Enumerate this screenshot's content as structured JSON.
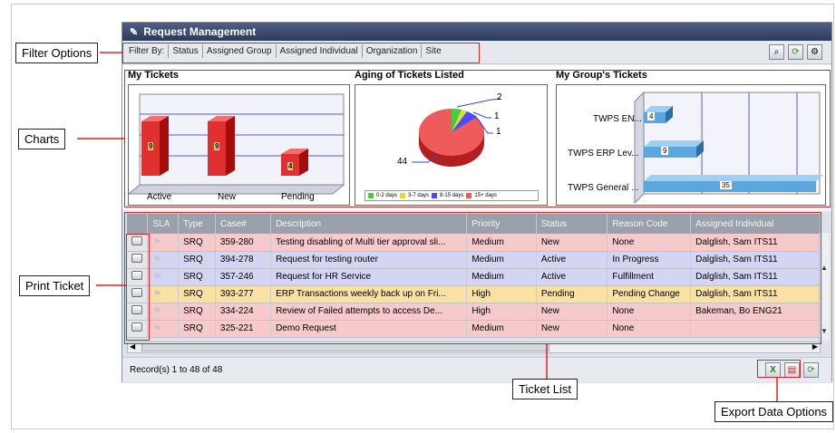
{
  "title": "Request Management",
  "filters": [
    "Filter By:",
    "Status",
    "Assigned Group",
    "Assigned Individual",
    "Organization",
    "Site"
  ],
  "charts": {
    "my_tickets": {
      "title": "My Tickets",
      "categories": [
        "Active",
        "New",
        "Pending"
      ],
      "values": [
        "9",
        "9",
        "4"
      ]
    },
    "aging": {
      "title": "Aging of Tickets Listed",
      "labels": [
        "2",
        "1",
        "1",
        "44"
      ],
      "legend": [
        "0-2 days",
        "3-7 days",
        "8-15 days",
        "15+ days"
      ]
    },
    "group": {
      "title": "My Group's Tickets",
      "categories": [
        "TWPS EN...",
        "TWPS ERP Lev...",
        "TWPS General ..."
      ],
      "values": [
        "4",
        "9",
        "35"
      ]
    }
  },
  "chart_data": [
    {
      "type": "bar",
      "title": "My Tickets",
      "categories": [
        "Active",
        "New",
        "Pending"
      ],
      "values": [
        9,
        9,
        4
      ]
    },
    {
      "type": "pie",
      "title": "Aging of Tickets Listed",
      "categories": [
        "0-2 days",
        "3-7 days",
        "8-15 days",
        "15+ days"
      ],
      "values": [
        1,
        1,
        2,
        44
      ]
    },
    {
      "type": "bar",
      "title": "My Group's Tickets",
      "categories": [
        "TWPS EN...",
        "TWPS ERP Lev...",
        "TWPS General ..."
      ],
      "values": [
        4,
        9,
        35
      ]
    }
  ],
  "table": {
    "columns": [
      "SLA",
      "Type",
      "Case#",
      "Description",
      "Priority",
      "Status",
      "Reason Code",
      "Assigned Individual"
    ],
    "rows": [
      [
        "SRQ",
        "359-280",
        "Testing disabling of Multi tier approval sli...",
        "Medium",
        "New",
        "None",
        "Dalglish, Sam ITS11"
      ],
      [
        "SRQ",
        "394-278",
        "Request for testing router",
        "Medium",
        "Active",
        "In Progress",
        "Dalglish, Sam ITS11"
      ],
      [
        "SRQ",
        "357-246",
        "Request for HR Service",
        "Medium",
        "Active",
        "Fulfillment",
        "Dalglish, Sam ITS11"
      ],
      [
        "SRQ",
        "393-277",
        "ERP Transactions weekly back up on Fri...",
        "High",
        "Pending",
        "Pending Change",
        "Dalglish, Sam ITS11"
      ],
      [
        "SRQ",
        "334-224",
        "Review of Failed attempts to access De...",
        "High",
        "New",
        "None",
        "Bakeman, Bo ENG21"
      ],
      [
        "SRQ",
        "325-221",
        "Demo Request",
        "Medium",
        "New",
        "None",
        ""
      ]
    ]
  },
  "records": "Record(s) 1 to 48 of 48",
  "callouts": {
    "filter": "Filter Options",
    "charts": "Charts",
    "print": "Print Ticket",
    "ticket_list": "Ticket List",
    "export": "Export Data Options"
  }
}
